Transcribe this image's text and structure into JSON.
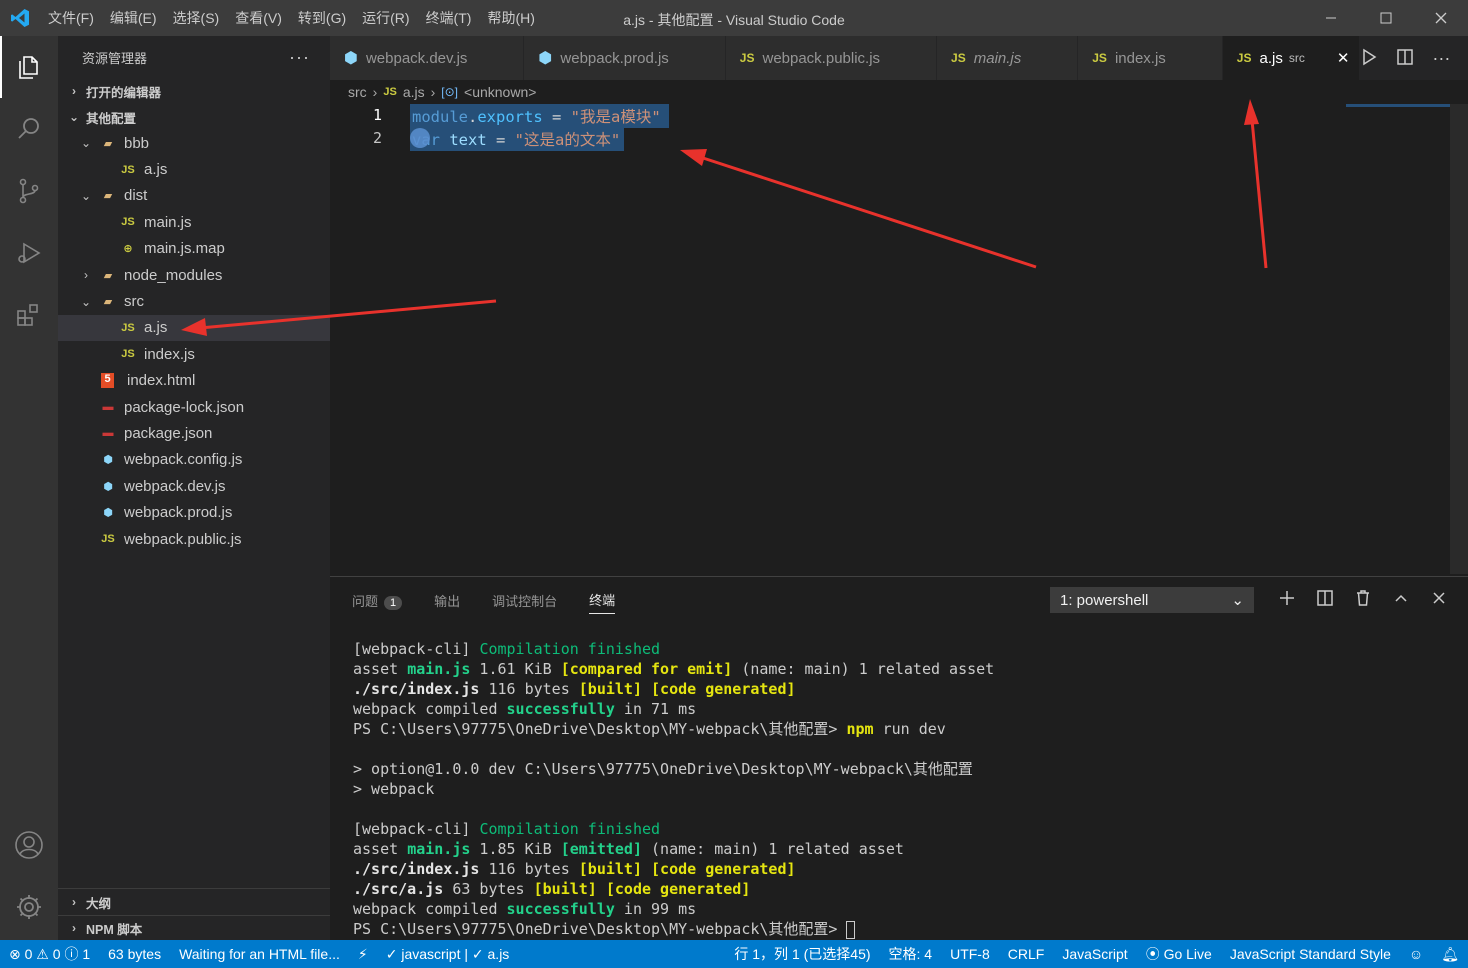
{
  "window": {
    "title": "a.js - 其他配置 - Visual Studio Code"
  },
  "menu": [
    "文件(F)",
    "编辑(E)",
    "选择(S)",
    "查看(V)",
    "转到(G)",
    "运行(R)",
    "终端(T)",
    "帮助(H)"
  ],
  "sidebar": {
    "title": "资源管理器",
    "open_editors": "打开的编辑器",
    "project": "其他配置",
    "tree": [
      {
        "label": "bbb",
        "type": "folder",
        "depth": 1,
        "open": true
      },
      {
        "label": "a.js",
        "type": "js",
        "depth": 2
      },
      {
        "label": "dist",
        "type": "folder",
        "depth": 1,
        "open": true
      },
      {
        "label": "main.js",
        "type": "js",
        "depth": 2
      },
      {
        "label": "main.js.map",
        "type": "map",
        "depth": 2
      },
      {
        "label": "node_modules",
        "type": "folder",
        "depth": 1,
        "open": false
      },
      {
        "label": "src",
        "type": "folder",
        "depth": 1,
        "open": true
      },
      {
        "label": "a.js",
        "type": "js",
        "depth": 2,
        "selected": true
      },
      {
        "label": "index.js",
        "type": "js",
        "depth": 2
      },
      {
        "label": "index.html",
        "type": "html",
        "depth": 1
      },
      {
        "label": "package-lock.json",
        "type": "npm",
        "depth": 1
      },
      {
        "label": "package.json",
        "type": "npm",
        "depth": 1
      },
      {
        "label": "webpack.config.js",
        "type": "webpack",
        "depth": 1
      },
      {
        "label": "webpack.dev.js",
        "type": "webpack",
        "depth": 1
      },
      {
        "label": "webpack.prod.js",
        "type": "webpack",
        "depth": 1
      },
      {
        "label": "webpack.public.js",
        "type": "js",
        "depth": 1
      }
    ],
    "outline": "大纲",
    "npm_scripts": "NPM 脚本"
  },
  "tabs": [
    {
      "label": "webpack.dev.js",
      "icon": "webpack"
    },
    {
      "label": "webpack.prod.js",
      "icon": "webpack"
    },
    {
      "label": "webpack.public.js",
      "icon": "js"
    },
    {
      "label": "main.js",
      "icon": "js",
      "italic": true
    },
    {
      "label": "index.js",
      "icon": "js"
    },
    {
      "label": "a.js",
      "icon": "js",
      "suffix": "src",
      "active": true
    }
  ],
  "breadcrumb": {
    "folder": "src",
    "file": "a.js",
    "symbol": "<unknown>"
  },
  "code": {
    "line_numbers": [
      "1",
      "2"
    ],
    "line1": {
      "kw": "module",
      "dot": ".",
      "prop": "exports",
      "op": " = ",
      "str": "\"我是a模块\""
    },
    "line2": {
      "kw": "var",
      "sp": " ",
      "name": "text",
      "op": " = ",
      "str": "\"这是a的文本\""
    }
  },
  "panel": {
    "tabs": [
      "问题",
      "输出",
      "调试控制台",
      "终端"
    ],
    "problems_count": "1",
    "terminal_select": "1: powershell"
  },
  "terminal": {
    "b1_l1_a": "[webpack-cli] ",
    "b1_l1_b": "Compilation finished",
    "b1_l2_a": "asset ",
    "b1_l2_b": "main.js",
    "b1_l2_c": " 1.61 KiB ",
    "b1_l2_d": "[compared for emit]",
    "b1_l2_e": " (name: main) 1 related asset",
    "b1_l3_a": "./src/index.js",
    "b1_l3_b": " 116 bytes ",
    "b1_l3_c": "[built]",
    "b1_l3_d": " ",
    "b1_l3_e": "[code generated]",
    "b1_l4_a": "webpack compiled ",
    "b1_l4_b": "successfully",
    "b1_l4_c": " in 71 ms",
    "prompt1_a": "PS C:\\Users\\97775\\OneDrive\\Desktop\\MY-webpack\\其他配置> ",
    "prompt1_b": "npm",
    "prompt1_c": " run dev",
    "npm_l1": "> option@1.0.0 dev C:\\Users\\97775\\OneDrive\\Desktop\\MY-webpack\\其他配置",
    "npm_l2": "> webpack",
    "b2_l1_a": "[webpack-cli] ",
    "b2_l1_b": "Compilation finished",
    "b2_l2_a": "asset ",
    "b2_l2_b": "main.js",
    "b2_l2_c": " 1.85 KiB ",
    "b2_l2_d": "[emitted]",
    "b2_l2_e": " (name: main) 1 related asset",
    "b2_l3_a": "./src/index.js",
    "b2_l3_b": " 116 bytes ",
    "b2_l3_c": "[built]",
    "b2_l3_d": " ",
    "b2_l3_e": "[code generated]",
    "b2_l4_a": "./src/a.js",
    "b2_l4_b": " 63 bytes ",
    "b2_l4_c": "[built]",
    "b2_l4_d": " ",
    "b2_l4_e": "[code generated]",
    "b2_l5_a": "webpack compiled ",
    "b2_l5_b": "successfully",
    "b2_l5_c": " in 99 ms",
    "prompt2": "PS C:\\Users\\97775\\OneDrive\\Desktop\\MY-webpack\\其他配置> "
  },
  "status": {
    "errors": "0",
    "warnings": "0",
    "infos": "1",
    "size": "63 bytes",
    "waiting": "Waiting for an HTML file...",
    "lang_check": "javascript | ",
    "file_check": "a.js",
    "position": "行 1，列 1 (已选择45)",
    "spaces": "空格: 4",
    "encoding": "UTF-8",
    "eol": "CRLF",
    "language": "JavaScript",
    "golive": "Go Live",
    "style": "JavaScript Standard Style"
  },
  "colors": {
    "accent": "#007acc",
    "selection": "#264f78",
    "arrow": "#e8322c"
  }
}
